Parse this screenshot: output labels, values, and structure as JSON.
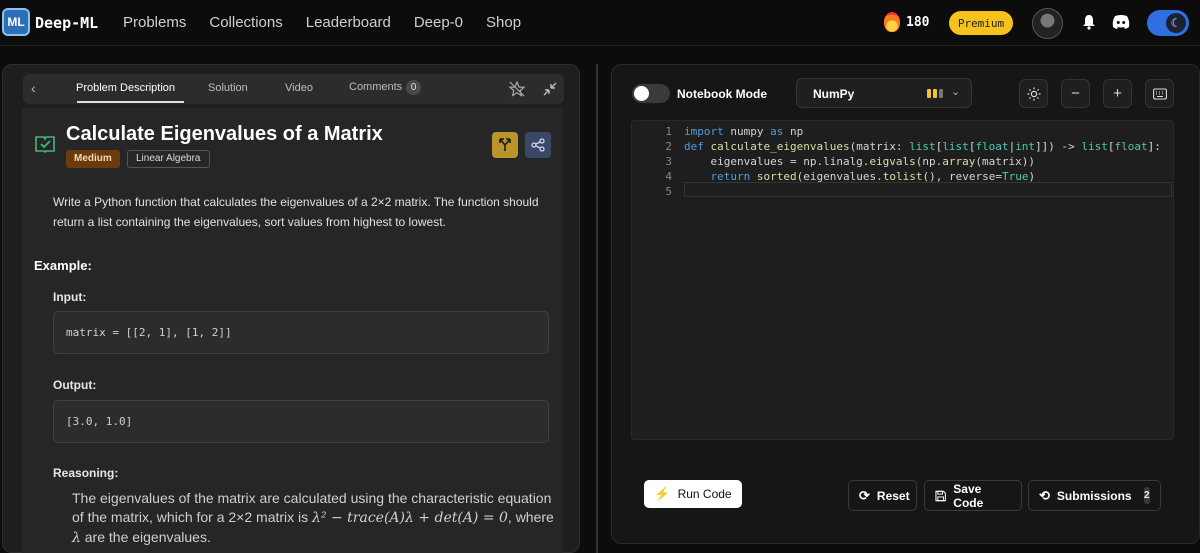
{
  "brand": {
    "logo_text": "ML",
    "name": "Deep-ML"
  },
  "nav": [
    "Problems",
    "Collections",
    "Leaderboard",
    "Deep-0",
    "Shop"
  ],
  "user": {
    "streak": "180",
    "premium_label": "Premium"
  },
  "problem_tabs": {
    "items": [
      "Problem Description",
      "Solution",
      "Video",
      "Comments"
    ],
    "comments_count": "0",
    "active": "Problem Description"
  },
  "problem": {
    "title": "Calculate Eigenvalues of a Matrix",
    "difficulty": "Medium",
    "topic": "Linear Algebra",
    "description": "Write a Python function that calculates the eigenvalues of a 2×2 matrix. The function should return a list containing the eigenvalues, sort values from highest to lowest.",
    "example_heading": "Example:",
    "input_heading": "Input:",
    "input_value": "matrix = [[2, 1], [1, 2]]",
    "output_heading": "Output:",
    "output_value": "[3.0, 1.0]",
    "reasoning_heading": "Reasoning:",
    "reasoning_pre": "The eigenvalues of the matrix are calculated using the characteristic equation of the matrix, which for a 2×2 matrix is ",
    "reasoning_math": "λ² − trace(A)λ + det(A) = 0",
    "reasoning_mid": ", where ",
    "reasoning_math2": "λ",
    "reasoning_post": " are the eigenvalues."
  },
  "editor_toolbar": {
    "notebook_label": "Notebook Mode",
    "notebook_on": false,
    "library": "NumPy"
  },
  "code": {
    "line_numbers": [
      "1",
      "2",
      "3",
      "4",
      "5"
    ],
    "lines": [
      "import numpy as np",
      "def calculate_eigenvalues(matrix: list[list[float|int]]) -> list[float]:",
      "    eigenvalues = np.linalg.eigvals(np.array(matrix))",
      "    return sorted(eigenvalues.tolist(), reverse=True)",
      ""
    ]
  },
  "actions": {
    "run": "Run Code",
    "reset": "Reset",
    "save": "Save Code",
    "submissions": "Submissions",
    "submissions_count": "2"
  },
  "colors": {
    "accent_premium": "#f7c21b",
    "difficulty_bg": "#6b3a0f",
    "theme_toggle": "#2f6fe0"
  }
}
